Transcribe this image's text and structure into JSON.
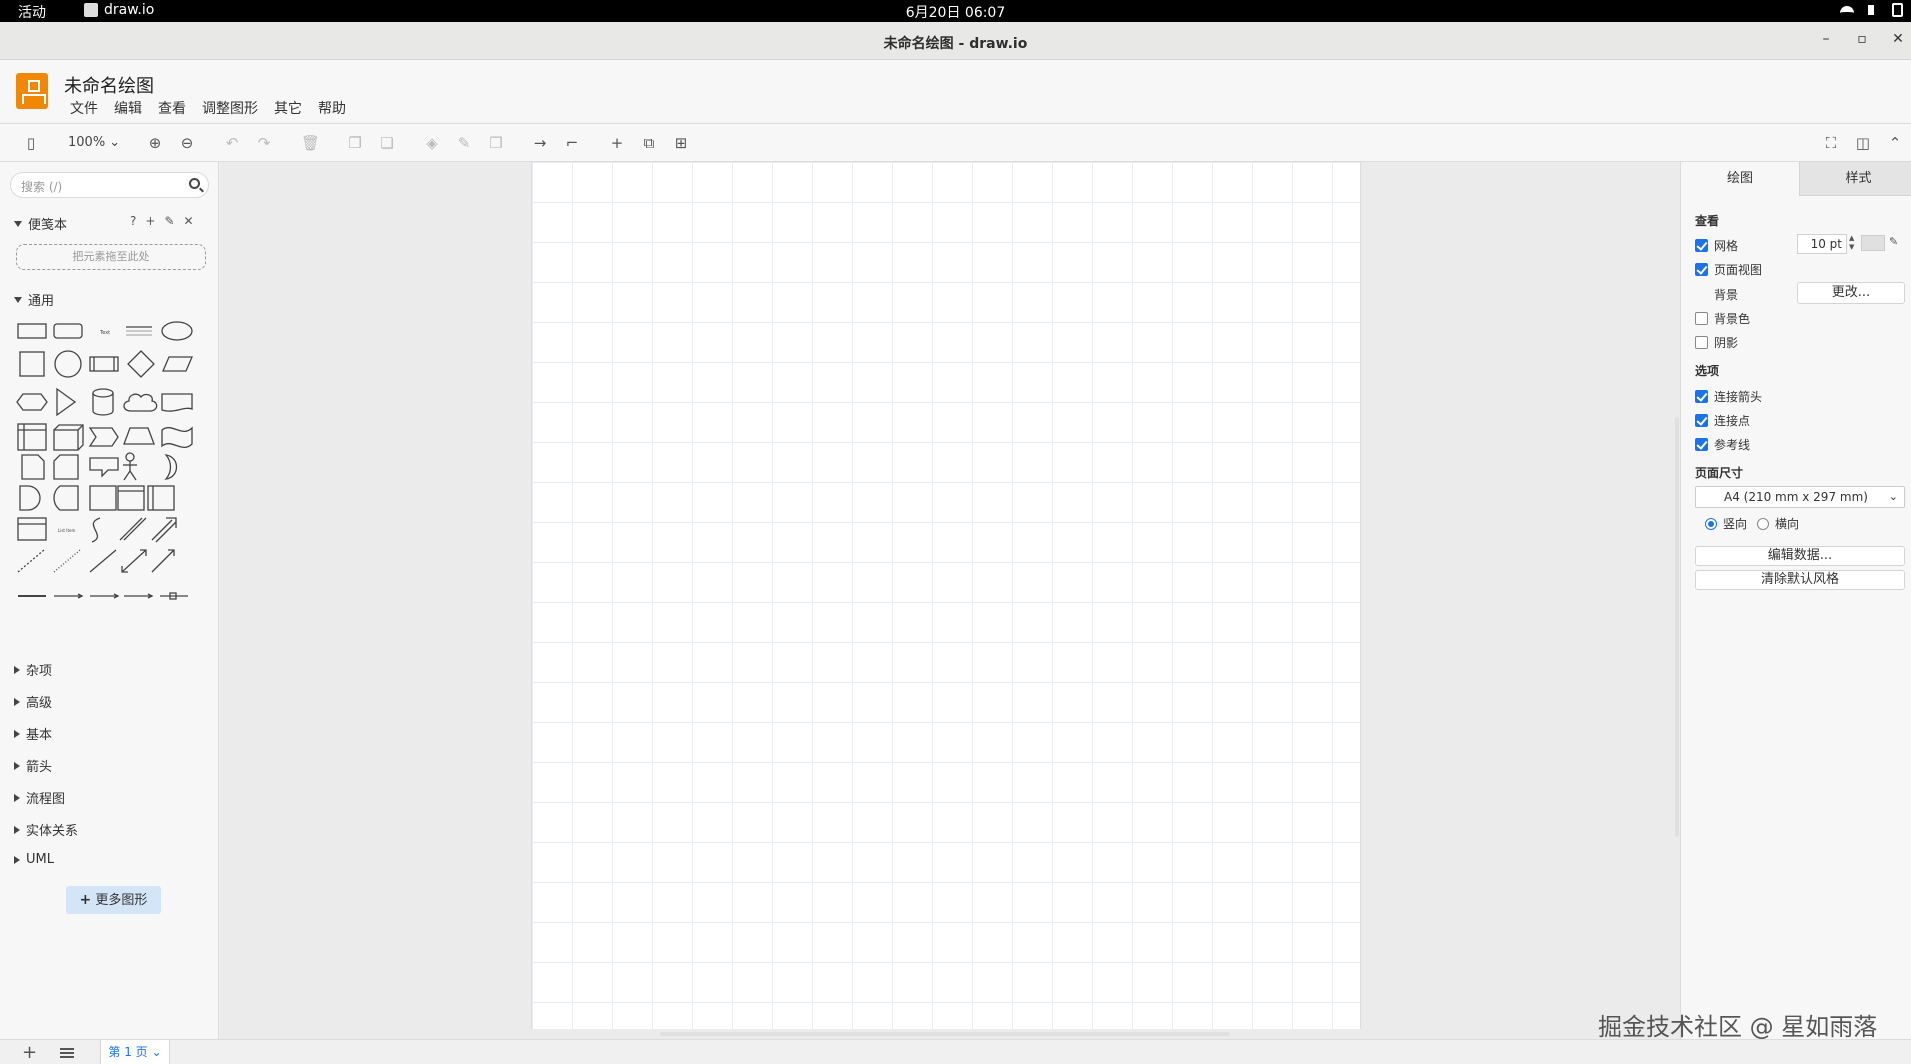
{
  "topbar": {
    "activities": "活动",
    "app": "draw.io",
    "clock": "6月20日 06:07"
  },
  "window": {
    "title": "未命名绘图 - draw.io"
  },
  "app": {
    "doc_title": "未命名绘图",
    "menus": [
      "文件",
      "编辑",
      "查看",
      "调整图形",
      "其它",
      "帮助"
    ]
  },
  "toolbar": {
    "zoom": "100%"
  },
  "sidebar": {
    "search_placeholder": "搜索 (/)",
    "scratchpad": {
      "title": "便笺本",
      "drop_hint": "把元素拖至此处"
    },
    "general_title": "通用",
    "collapsed_sections": [
      "杂项",
      "高级",
      "基本",
      "箭头",
      "流程图",
      "实体关系",
      "UML"
    ],
    "more_shapes": "更多图形"
  },
  "right_panel": {
    "tabs": [
      "绘图",
      "样式"
    ],
    "view_heading": "查看",
    "grid": {
      "label": "网格",
      "checked": true,
      "size": "10 pt"
    },
    "page_view": {
      "label": "页面视图",
      "checked": true
    },
    "background_label": "背景",
    "change_button": "更改...",
    "background_color": {
      "label": "背景色",
      "checked": false
    },
    "shadow": {
      "label": "阴影",
      "checked": false
    },
    "options_heading": "选项",
    "connection_arrows": {
      "label": "连接箭头",
      "checked": true
    },
    "connection_points": {
      "label": "连接点",
      "checked": true
    },
    "guides": {
      "label": "参考线",
      "checked": true
    },
    "page_size_heading": "页面尺寸",
    "page_size": "A4 (210 mm x 297 mm)",
    "portrait": {
      "label": "竖向",
      "selected": true
    },
    "landscape": {
      "label": "横向",
      "selected": false
    },
    "edit_data_button": "编辑数据...",
    "clear_style_button": "清除默认风格"
  },
  "bottombar": {
    "page_tab": "第 1 页"
  },
  "watermark": "掘金技术社区 @ 星如雨落"
}
